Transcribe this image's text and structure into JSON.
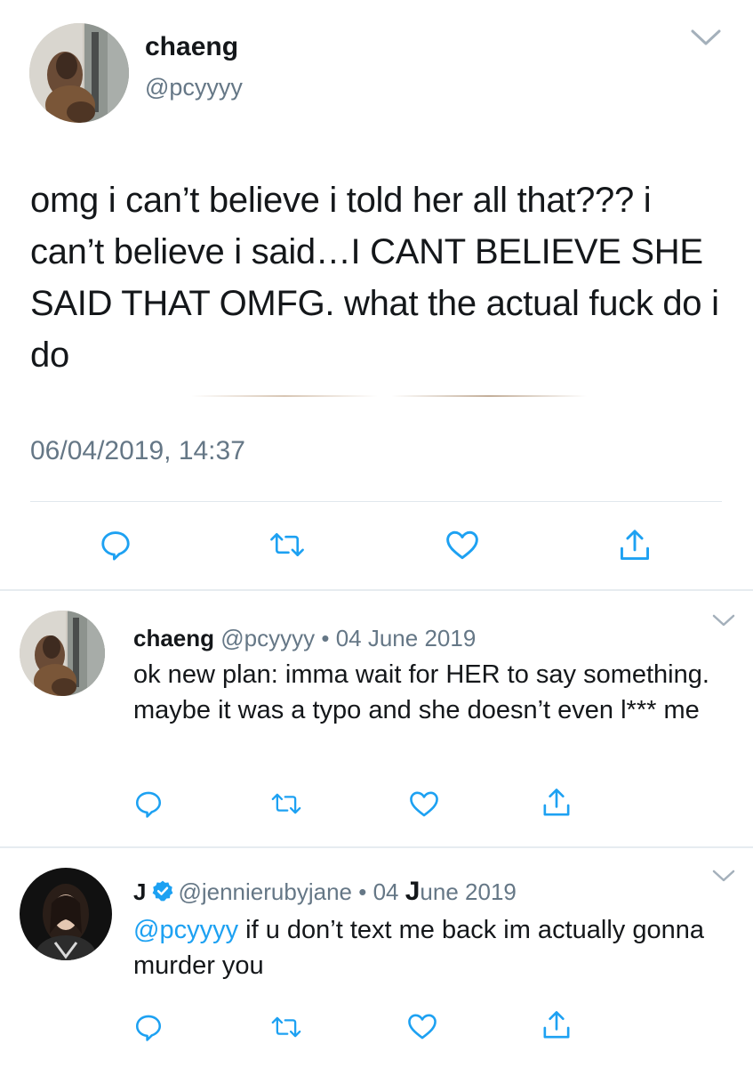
{
  "main_tweet": {
    "name": "chaeng",
    "handle": "@pcyyyy",
    "text": "omg i can’t believe i told her all that??? i can’t believe i said…I CANT BELIEVE SHE SAID THAT OMFG. what the actual fuck do i do",
    "timestamp": "06/04/2019, 14:37",
    "actions": [
      "reply-icon",
      "retweet-icon",
      "like-icon",
      "share-icon"
    ]
  },
  "replies": [
    {
      "name": "chaeng",
      "handle": "@pcyyyy",
      "separator": "•",
      "date": "04 June 2019",
      "text": "ok new plan: imma wait for HER to say something. maybe it was a typo and she doesn’t even l*** me",
      "verified": false
    },
    {
      "name": "J",
      "handle": "@jennierubyjane",
      "separator": "•",
      "date_prefix": "04 ",
      "date_bold": "J",
      "date_suffix": "une 2019",
      "mention": "@pcyyyy",
      "text": " if u don’t text me back im actually gonna murder you",
      "verified": true
    }
  ],
  "colors": {
    "text": "#14171a",
    "secondary": "#657786",
    "accent": "#1da1f2",
    "icon": "#1da1f2",
    "divider": "#e1e8ed"
  }
}
